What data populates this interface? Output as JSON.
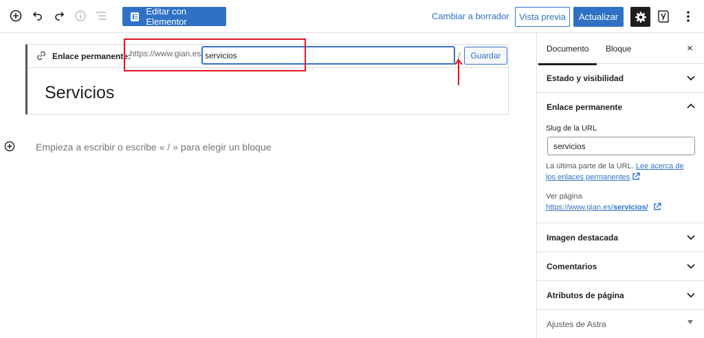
{
  "toolbar": {
    "elementor_label": "Editar con Elementor",
    "draft_label": "Cambiar a borrador",
    "preview_label": "Vista previa",
    "update_label": "Actualizar",
    "yoast_label": "y"
  },
  "permalink": {
    "label": "Enlace permanente:",
    "prefix": "https://www.gian.es/",
    "slug": "servicios",
    "slash": "/",
    "save_label": "Guardar"
  },
  "page": {
    "title": "Servicios",
    "block_placeholder": "Empieza a escribir o escribe « / » para elegir un bloque"
  },
  "sidebar": {
    "tabs": [
      "Documento",
      "Bloque"
    ],
    "close": "×",
    "sections": {
      "status": "Estado y visibilidad",
      "permalink": "Enlace permanente",
      "featured": "Imagen destacada",
      "comments": "Comentarios",
      "attributes": "Atributos de página",
      "astra": "Ajustes de Astra"
    },
    "slug_label": "Slug de la URL",
    "slug_value": "servicios",
    "help_text": "La última parte de la URL.",
    "help_link": "Lee acerca de los enlaces permanentes",
    "view_page_label": "Ver página",
    "view_url_base": "https://www.gian.es/",
    "view_url_slug": "servicios/"
  },
  "colors": {
    "accent": "#3071c6",
    "highlight": "#e0141e",
    "dark": "#1e1e1e"
  }
}
